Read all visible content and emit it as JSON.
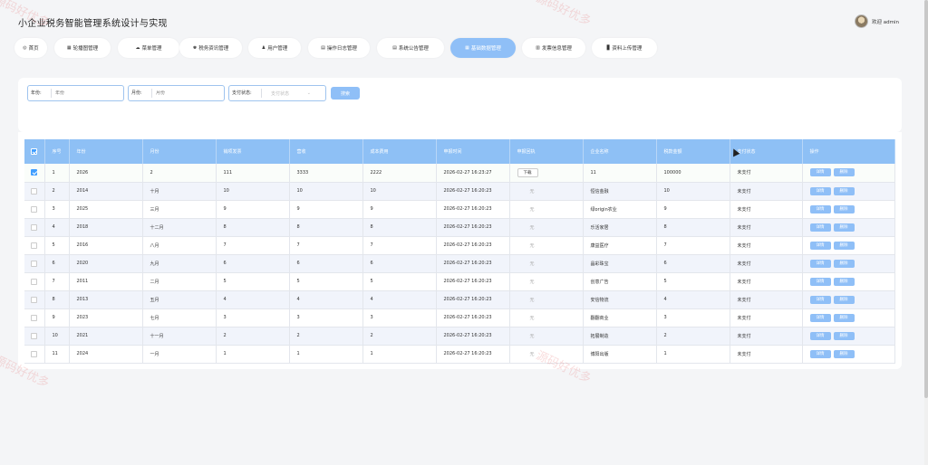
{
  "app": {
    "title": "小企业税务智能管理系统设计与实现",
    "welcome": "欢迎 admin"
  },
  "nav": [
    {
      "label": "首页",
      "icon": "◎"
    },
    {
      "label": "轮播图管理",
      "icon": "▦"
    },
    {
      "label": "菜单管理",
      "icon": "☁"
    },
    {
      "label": "税务资讯管理",
      "icon": "♚"
    },
    {
      "label": "用户管理",
      "icon": "♟"
    },
    {
      "label": "操作日志管理",
      "icon": "▤"
    },
    {
      "label": "系统公告管理",
      "icon": "▤"
    },
    {
      "label": "基础数据管理",
      "icon": "▦"
    },
    {
      "label": "发票信息管理",
      "icon": "▥"
    },
    {
      "label": "资料上传管理",
      "icon": "▊"
    }
  ],
  "search": {
    "year_label": "年份:",
    "year_placeholder": "年份",
    "month_label": "月份:",
    "month_placeholder": "月份",
    "status_label": "支付状态:",
    "status_placeholder": "支付状态",
    "search_button": "搜索"
  },
  "table": {
    "headers": [
      "序号",
      "年份",
      "月份",
      "销项发票",
      "营收",
      "成本费用",
      "申报时间",
      "申报回执",
      "企业名称",
      "税款金额",
      "支付状态",
      "操作"
    ],
    "detail_label": "详情",
    "delete_label": "删除",
    "download_label": "下载",
    "empty_label": "无",
    "rows": [
      {
        "no": "1",
        "year": "2026",
        "month": "2",
        "invoice": "111",
        "revenue": "3333",
        "cost": "2222",
        "time": "2026-02-27 16:23:27",
        "receipt": "下载",
        "company": "11",
        "tax": "100000",
        "status": "未支付",
        "checked": true
      },
      {
        "no": "2",
        "year": "2014",
        "month": "十月",
        "invoice": "10",
        "revenue": "10",
        "cost": "10",
        "time": "2026-02-27 16:20:23",
        "receipt": "无",
        "company": "恒信金融",
        "tax": "10",
        "status": "未支付"
      },
      {
        "no": "3",
        "year": "2025",
        "month": "三月",
        "invoice": "9",
        "revenue": "9",
        "cost": "9",
        "time": "2026-02-27 16:20:23",
        "receipt": "无",
        "company": "绿origin农业",
        "tax": "9",
        "status": "未支付"
      },
      {
        "no": "4",
        "year": "2018",
        "month": "十二月",
        "invoice": "8",
        "revenue": "8",
        "cost": "8",
        "time": "2026-02-27 16:20:23",
        "receipt": "无",
        "company": "乐活家居",
        "tax": "8",
        "status": "未支付"
      },
      {
        "no": "5",
        "year": "2016",
        "month": "八月",
        "invoice": "7",
        "revenue": "7",
        "cost": "7",
        "time": "2026-02-27 16:20:23",
        "receipt": "无",
        "company": "康益医疗",
        "tax": "7",
        "status": "未支付"
      },
      {
        "no": "6",
        "year": "2020",
        "month": "九月",
        "invoice": "6",
        "revenue": "6",
        "cost": "6",
        "time": "2026-02-27 16:20:23",
        "receipt": "无",
        "company": "晶彩珠宝",
        "tax": "6",
        "status": "未支付"
      },
      {
        "no": "7",
        "year": "2011",
        "month": "二月",
        "invoice": "5",
        "revenue": "5",
        "cost": "5",
        "time": "2026-02-27 16:20:23",
        "receipt": "无",
        "company": "创意广告",
        "tax": "5",
        "status": "未支付"
      },
      {
        "no": "8",
        "year": "2013",
        "month": "五月",
        "invoice": "4",
        "revenue": "4",
        "cost": "4",
        "time": "2026-02-27 16:20:23",
        "receipt": "无",
        "company": "安信物流",
        "tax": "4",
        "status": "未支付"
      },
      {
        "no": "9",
        "year": "2023",
        "month": "七月",
        "invoice": "3",
        "revenue": "3",
        "cost": "3",
        "time": "2026-02-27 16:20:23",
        "receipt": "无",
        "company": "翻翻商业",
        "tax": "3",
        "status": "未支付"
      },
      {
        "no": "10",
        "year": "2021",
        "month": "十一月",
        "invoice": "2",
        "revenue": "2",
        "cost": "2",
        "time": "2026-02-27 16:20:23",
        "receipt": "无",
        "company": "拓展制造",
        "tax": "2",
        "status": "未支付"
      },
      {
        "no": "11",
        "year": "2024",
        "month": "一月",
        "invoice": "1",
        "revenue": "1",
        "cost": "1",
        "time": "2026-02-27 16:20:23",
        "receipt": "无",
        "company": "博阳出版",
        "tax": "1",
        "status": "未支付"
      }
    ]
  },
  "watermark": "源码好优多",
  "colors": {
    "accent": "#8fbff7",
    "header": "#8ec0f5",
    "checkbox": "#409eff"
  }
}
